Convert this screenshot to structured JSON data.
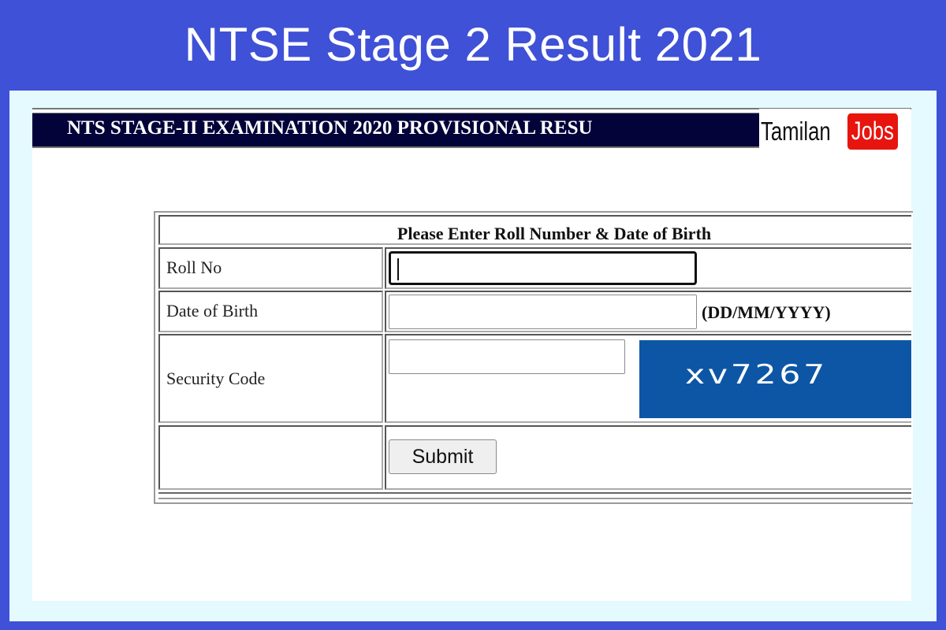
{
  "banner": {
    "title": "NTSE Stage 2 Result 2021"
  },
  "page": {
    "header_text": "NTS STAGE-II EXAMINATION 2020 PROVISIONAL RESU",
    "logo": {
      "part1": "Tamilan",
      "part2": "Jobs",
      "accent_color": "#e8140e"
    }
  },
  "form": {
    "heading": "Please Enter Roll Number & Date of Birth",
    "fields": [
      {
        "label": "Roll No",
        "value": "",
        "focused": true
      },
      {
        "label": "Date of Birth",
        "value": "",
        "hint": "(DD/MM/YYYY)"
      },
      {
        "label": "Security Code",
        "value": ""
      }
    ],
    "captcha": {
      "code": "xv7267",
      "background_color": "#0d56a5"
    },
    "submit_label": "Submit"
  },
  "colors": {
    "banner_bg": "#3f51d6",
    "header_bar_bg": "#03033a",
    "screen_bg": "#e4fafe"
  }
}
